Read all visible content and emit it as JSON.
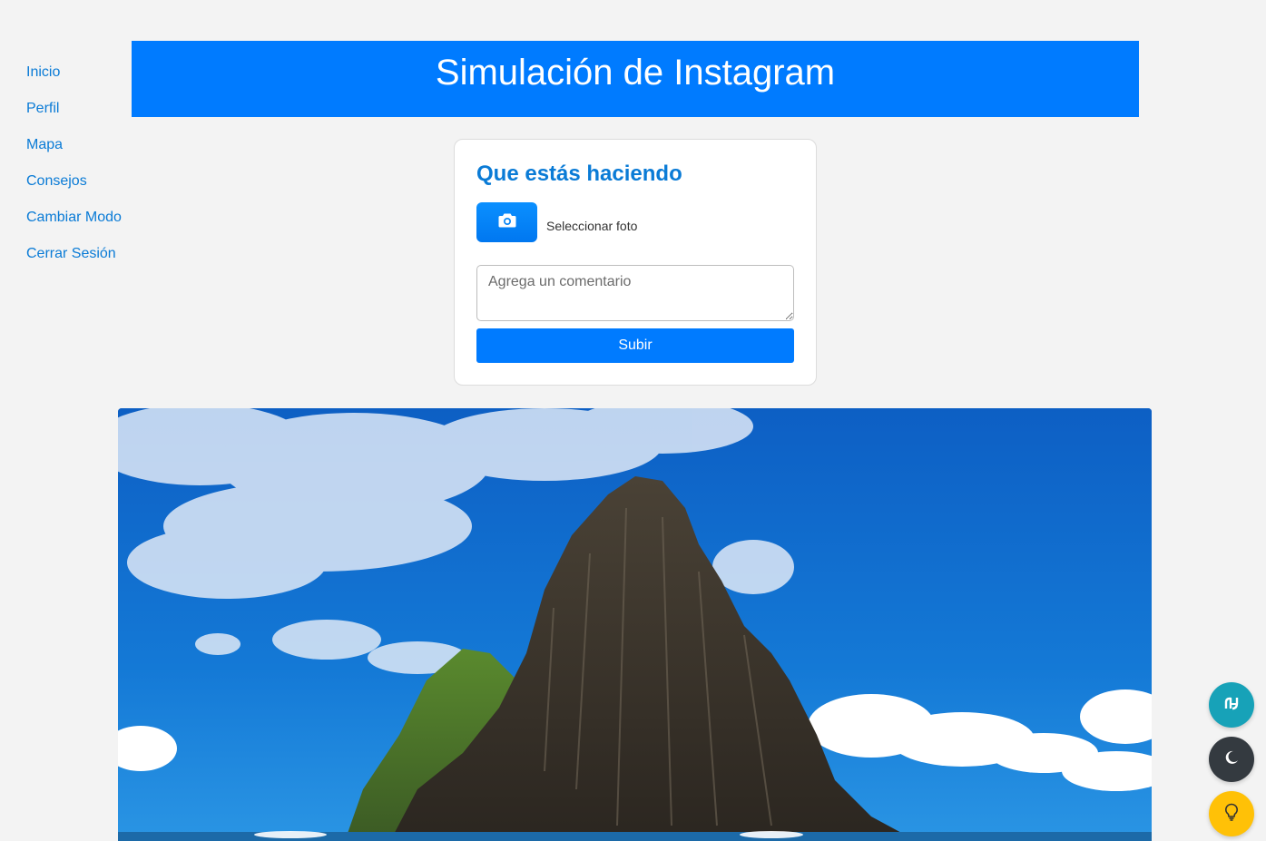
{
  "sidebar": {
    "items": [
      {
        "label": "Inicio"
      },
      {
        "label": "Perfil"
      },
      {
        "label": "Mapa"
      },
      {
        "label": "Consejos"
      },
      {
        "label": "Cambiar Modo"
      },
      {
        "label": "Cerrar Sesión"
      }
    ]
  },
  "header": {
    "title": "Simulación de Instagram"
  },
  "post_form": {
    "heading": "Que estás haciendo",
    "photo_button_icon": "camera-icon",
    "photo_label": "Seleccionar foto",
    "comment_placeholder": "Agrega un comentario",
    "comment_value": "",
    "submit_label": "Subir"
  },
  "feed": {
    "image_icon": "landscape-photo-rock-sea"
  },
  "floating_buttons": [
    {
      "icon": "translate-icon",
      "color": "#17a2b8"
    },
    {
      "icon": "moon-icon",
      "color": "#343a40"
    },
    {
      "icon": "lightbulb-icon",
      "color": "#ffc107"
    }
  ],
  "colors": {
    "accent": "#007bff",
    "link": "#0a7bd6",
    "background": "#f3f3f3"
  }
}
